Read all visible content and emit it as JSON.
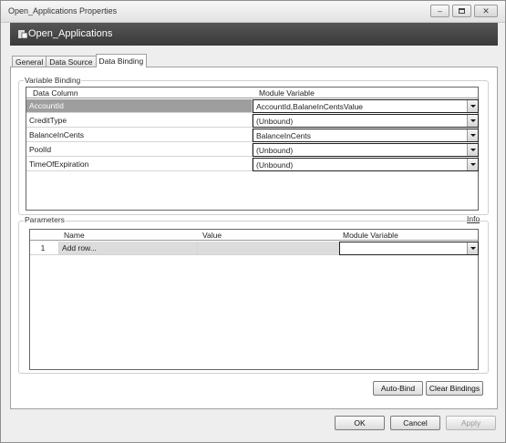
{
  "window": {
    "title": "Open_Applications Properties",
    "controls": [
      "minimize",
      "maximize",
      "close"
    ]
  },
  "header": {
    "title": "Open_Applications",
    "icon": "component-icon"
  },
  "tabs": [
    {
      "label": "General",
      "active": false
    },
    {
      "label": "Data Source",
      "active": false
    },
    {
      "label": "Data Binding",
      "active": true
    }
  ],
  "variable_binding": {
    "label": "Variable Binding",
    "columns": [
      "Data Column",
      "Module Variable"
    ],
    "rows": [
      {
        "column": "AccountId",
        "variable": "AccountId,BalaneInCentsValue",
        "selected": true
      },
      {
        "column": "CreditType",
        "variable": "(Unbound)",
        "selected": false
      },
      {
        "column": "BalanceInCents",
        "variable": "BalanceInCents",
        "selected": false
      },
      {
        "column": "PoolId",
        "variable": "(Unbound)",
        "selected": false
      },
      {
        "column": "TimeOfExpiration",
        "variable": "(Unbound)",
        "selected": false
      }
    ]
  },
  "parameters": {
    "label": "Parameters",
    "info_link": "Info",
    "columns": [
      "Name",
      "Value",
      "Module Variable"
    ],
    "rows": [
      {
        "index": "1",
        "name": "Add row...",
        "value": "",
        "variable": ""
      }
    ]
  },
  "actions": {
    "auto_bind": "Auto-Bind",
    "clear_bindings": "Clear Bindings"
  },
  "footer": {
    "ok": "OK",
    "cancel": "Cancel",
    "apply": "Apply",
    "apply_enabled": false
  },
  "colors": {
    "header_bg": "#444444",
    "selected_row": "#9e9e9e"
  }
}
